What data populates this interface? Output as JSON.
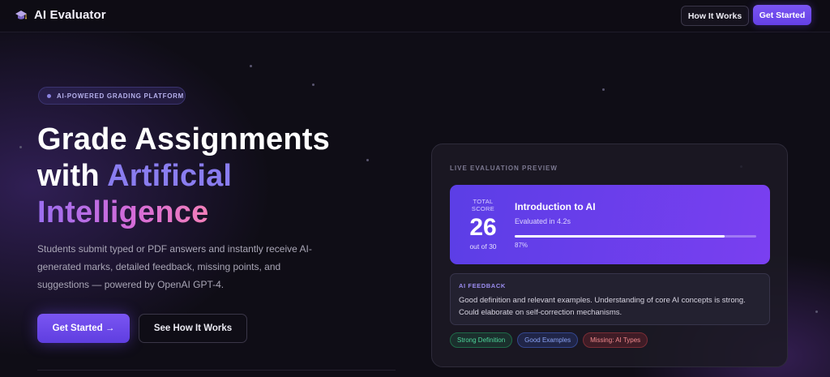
{
  "app": {
    "name": "AI Evaluator",
    "logo_icon": "mortarboard-icon"
  },
  "nav": {
    "how_it_works": "How It Works",
    "get_started": "Get Started"
  },
  "hero": {
    "badge": "AI-POWERED GRADING PLATFORM",
    "headline_line1": "Grade Assignments",
    "headline_line2_plain": "with",
    "headline_line2_accent": "Artificial",
    "headline_line3_accent": "Intelligence",
    "description": "Students submit typed or PDF answers and instantly receive AI-generated marks, detailed feedback, missing points, and suggestions — powered by OpenAI GPT-4.",
    "cta_primary": "Get Started →",
    "cta_secondary": "See How It Works"
  },
  "preview": {
    "label": "LIVE EVALUATION PREVIEW",
    "score": {
      "label": "TOTAL SCORE",
      "value": "26",
      "out_of": "out of 30",
      "title": "Introduction to AI",
      "evaluated": "Evaluated in 4.2s",
      "progress_percent": 87,
      "progress_text": "87%"
    },
    "feedback": {
      "title": "AI FEEDBACK",
      "text": "Good definition and relevant examples. Understanding of core AI concepts is strong. Could elaborate on self-correction mechanisms."
    },
    "tags": [
      {
        "label": "Strong Definition",
        "tone": "positive"
      },
      {
        "label": "Good Examples",
        "tone": "info"
      },
      {
        "label": "Missing: AI Types",
        "tone": "negative"
      }
    ]
  },
  "colors": {
    "background": "#0f0d16",
    "accent": "#6b48ee",
    "accent_text": "#8a7df0",
    "gradient_pink": "#f27fb8",
    "tag_green": "#4ed69a",
    "tag_blue": "#8aa3f5",
    "tag_red": "#f28a8e"
  }
}
